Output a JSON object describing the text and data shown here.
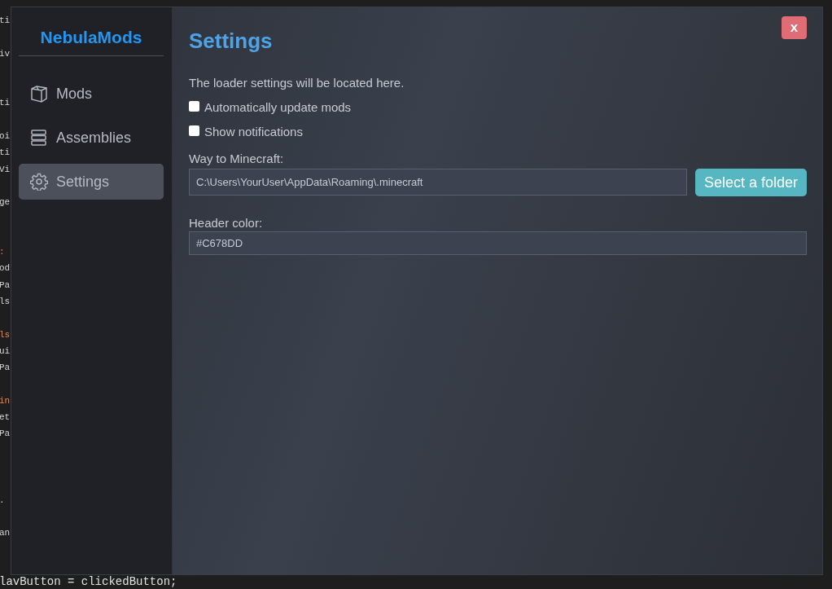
{
  "editor_backdrop": {
    "lines": [
      {
        "kind": "plain",
        "text": "ti"
      },
      {
        "kind": "blank"
      },
      {
        "kind": "plain",
        "text": "iv"
      },
      {
        "kind": "blank"
      },
      {
        "kind": "blank"
      },
      {
        "kind": "plain",
        "text": "ti"
      },
      {
        "kind": "blank"
      },
      {
        "kind": "plain",
        "text": "oi"
      },
      {
        "kind": "plain",
        "text": "ti"
      },
      {
        "kind": "plain",
        "text": "Vi"
      },
      {
        "kind": "blank"
      },
      {
        "kind": "plain",
        "text": "ge"
      },
      {
        "kind": "blank"
      },
      {
        "kind": "blank"
      },
      {
        "kind": "error",
        "text": ":"
      },
      {
        "kind": "plain",
        "text": "od"
      },
      {
        "kind": "plain",
        "text": "Pa"
      },
      {
        "kind": "plain",
        "text": "ls"
      },
      {
        "kind": "blank"
      },
      {
        "kind": "keyword",
        "text": "ls"
      },
      {
        "kind": "plain",
        "text": "ui"
      },
      {
        "kind": "plain",
        "text": "Pa"
      },
      {
        "kind": "blank"
      },
      {
        "kind": "keyword",
        "text": "in"
      },
      {
        "kind": "plain",
        "text": "et"
      },
      {
        "kind": "plain",
        "text": "Pa"
      },
      {
        "kind": "blank"
      },
      {
        "kind": "blank"
      },
      {
        "kind": "blank"
      },
      {
        "kind": "plain",
        "text": "."
      },
      {
        "kind": "blank"
      },
      {
        "kind": "plain",
        "text": "an"
      }
    ],
    "bottom_line": "lavButton = clickedButton;"
  },
  "sidebar": {
    "logo": "NebulaMods",
    "items": [
      {
        "label": "Mods",
        "kind": "box",
        "selected": false
      },
      {
        "label": "Assemblies",
        "kind": "stack",
        "selected": false
      },
      {
        "label": "Settings",
        "kind": "gear",
        "selected": true
      }
    ]
  },
  "close_button": {
    "label": "x"
  },
  "page": {
    "title": "Settings",
    "description": "The loader settings will be located here.",
    "checkboxes": [
      {
        "label": "Automatically update mods",
        "checked": false
      },
      {
        "label": "Show notifications",
        "checked": false
      }
    ],
    "path_field": {
      "label": "Way to Minecraft:",
      "value": "C:\\Users\\YourUser\\AppData\\Roaming\\.minecraft",
      "button": "Select a folder"
    },
    "color_field": {
      "label": "Header color:",
      "value": "#C678DD"
    }
  }
}
